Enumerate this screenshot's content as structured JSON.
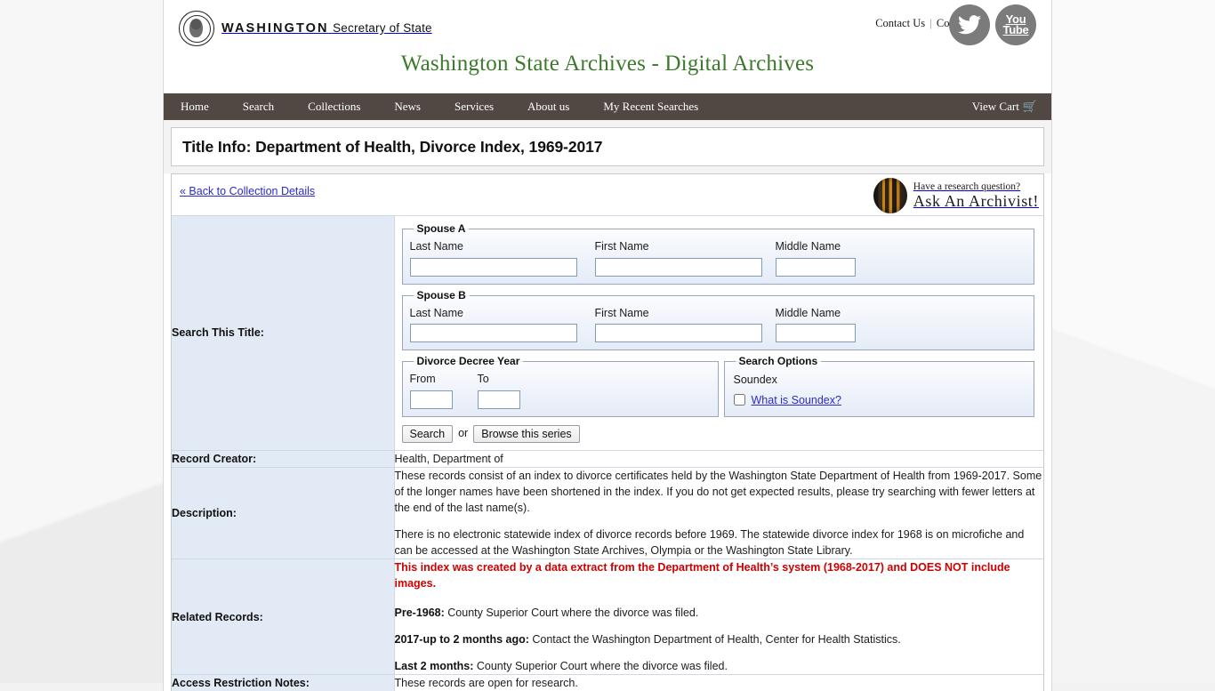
{
  "header": {
    "logo_state": "WASHINGTON",
    "logo_office": "Secretary of State",
    "contact_us": "Contact Us",
    "separator": "|",
    "connect": "Connect:",
    "social": [
      {
        "name": "twitter",
        "label": "Twitter"
      },
      {
        "name": "youtube",
        "label_top": "You",
        "label_bottom": "Tube"
      }
    ],
    "site_title": "Washington State Archives - Digital Archives"
  },
  "nav": {
    "items": [
      {
        "label": "Home"
      },
      {
        "label": "Search"
      },
      {
        "label": "Collections"
      },
      {
        "label": "News"
      },
      {
        "label": "Services"
      },
      {
        "label": "About us"
      },
      {
        "label": "My Recent Searches"
      }
    ],
    "cart_label": "View Cart",
    "cart_icon": "cart-icon"
  },
  "page": {
    "title": "Title Info: Department of Health, Divorce Index, 1969-2017",
    "back_link": "« Back to Collection Details",
    "ask_archivist": {
      "line1": "Have a research question?",
      "line2": "Ask An Archivist!"
    }
  },
  "search_form": {
    "row_label": "Search This Title:",
    "spouse_a": {
      "legend": "Spouse A",
      "last_name_label": "Last Name",
      "last_name_value": "",
      "first_name_label": "First Name",
      "first_name_value": "",
      "middle_name_label": "Middle Name",
      "middle_name_value": ""
    },
    "spouse_b": {
      "legend": "Spouse B",
      "last_name_label": "Last Name",
      "last_name_value": "",
      "first_name_label": "First Name",
      "first_name_value": "",
      "middle_name_label": "Middle Name",
      "middle_name_value": ""
    },
    "decree_year": {
      "legend": "Divorce Decree Year",
      "from_label": "From",
      "from_value": "",
      "to_label": "To",
      "to_value": ""
    },
    "search_options": {
      "legend": "Search Options",
      "soundex_label": "Soundex",
      "soundex_checked": false,
      "soundex_link": "What is Soundex?"
    },
    "search_button": "Search",
    "or_text": "or",
    "browse_button": "Browse this series"
  },
  "details": {
    "record_creator": {
      "label": "Record Creator:",
      "value": "Health, Department of"
    },
    "description": {
      "label": "Description:",
      "paragraph_1": "These records consist of an index to divorce certificates held by the Washington State Department of Health from 1969-2017. Some of the longer names have been shortened in the index. If you do not get expected results, please try searching with fewer letters at the end of the last name(s).",
      "paragraph_2": "There is no electronic statewide index of divorce records before 1969. The statewide divorce index for 1968 is on microfiche and can be accessed at the Washington State Archives, Olympia or the Washington State Library."
    },
    "related_records": {
      "label": "Related Records:",
      "warning": "This index was created by a data extract from the Department of Health’s system (1968-2017) and DOES NOT include images.",
      "item_1_bold": "Pre-1968:",
      "item_1_text": " County Superior Court where the divorce was filed.",
      "item_2_bold": "2017-up to 2 months ago:",
      "item_2_text": " Contact the Washington Department of Health, Center for Health Statistics.",
      "item_3_bold": "Last 2 months:",
      "item_3_text": " County Superior Court where the divorce was filed."
    },
    "access_restriction": {
      "label": "Access Restriction Notes:",
      "value": "These records are open for research."
    }
  },
  "colors": {
    "nav_bar": "#514843",
    "site_title_green": "#3b7a2a",
    "label_cell_blue": "#e2eaf5",
    "link_blue": "#2a2ad0",
    "warning_red": "#cf0000",
    "social_gray": "#7b7b7b"
  }
}
